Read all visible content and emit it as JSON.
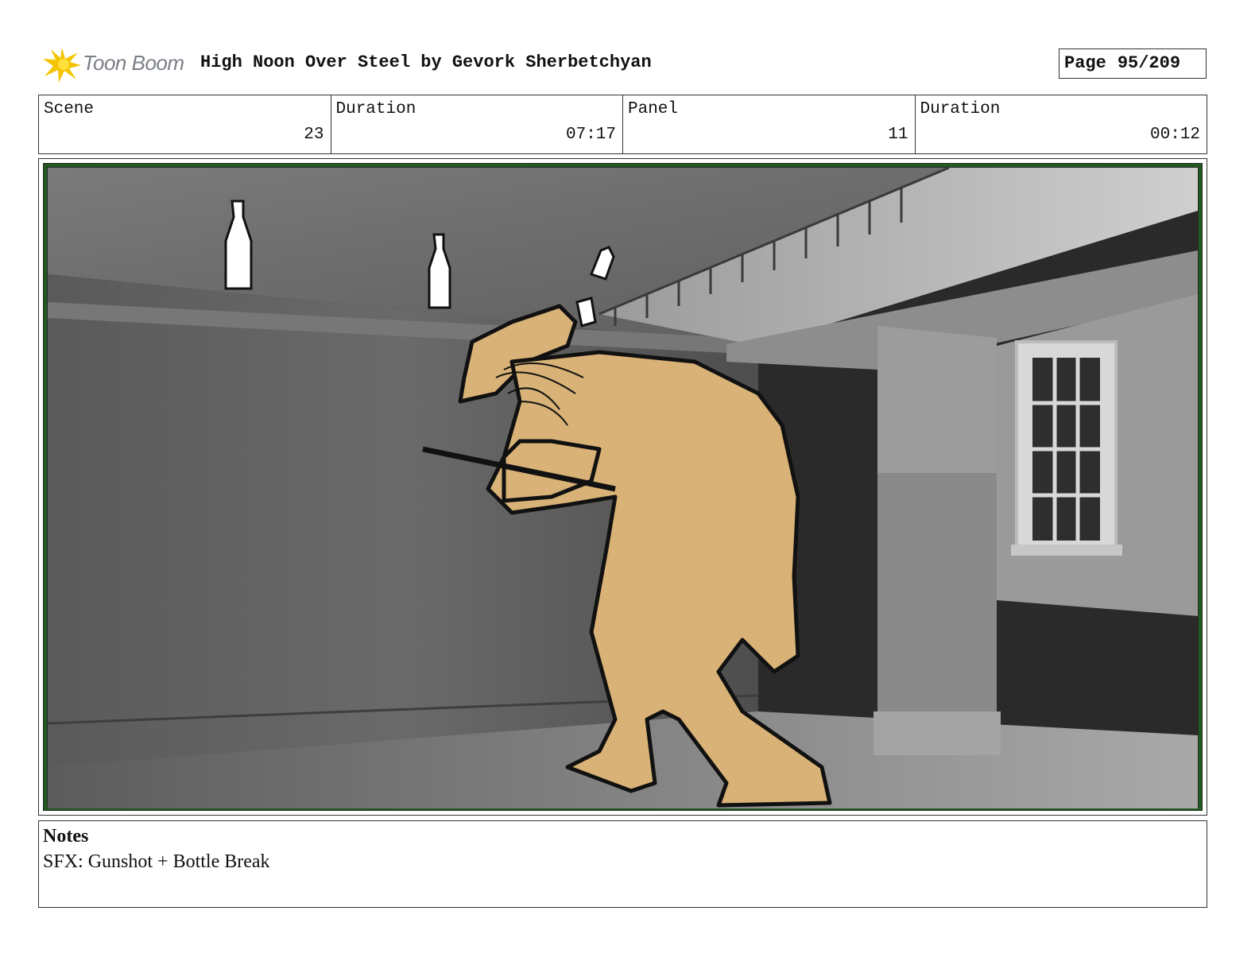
{
  "header": {
    "logo_text": "Toon Boom",
    "title": "High Noon Over Steel by Gevork Sherbetchyan",
    "page_label": "Page",
    "page_number": "95/209"
  },
  "info": {
    "scene_label": "Scene",
    "scene_value": "23",
    "scene_duration_label": "Duration",
    "scene_duration_value": "07:17",
    "panel_label": "Panel",
    "panel_value": "11",
    "panel_duration_label": "Duration",
    "panel_duration_value": "00:12"
  },
  "notes": {
    "heading": "Notes",
    "text": "SFX: Gunshot + Bottle Break"
  },
  "colors": {
    "logo_accent": "#f5c400",
    "panel_frame": "#1f5a1f",
    "character_fill": "#d8b276"
  }
}
